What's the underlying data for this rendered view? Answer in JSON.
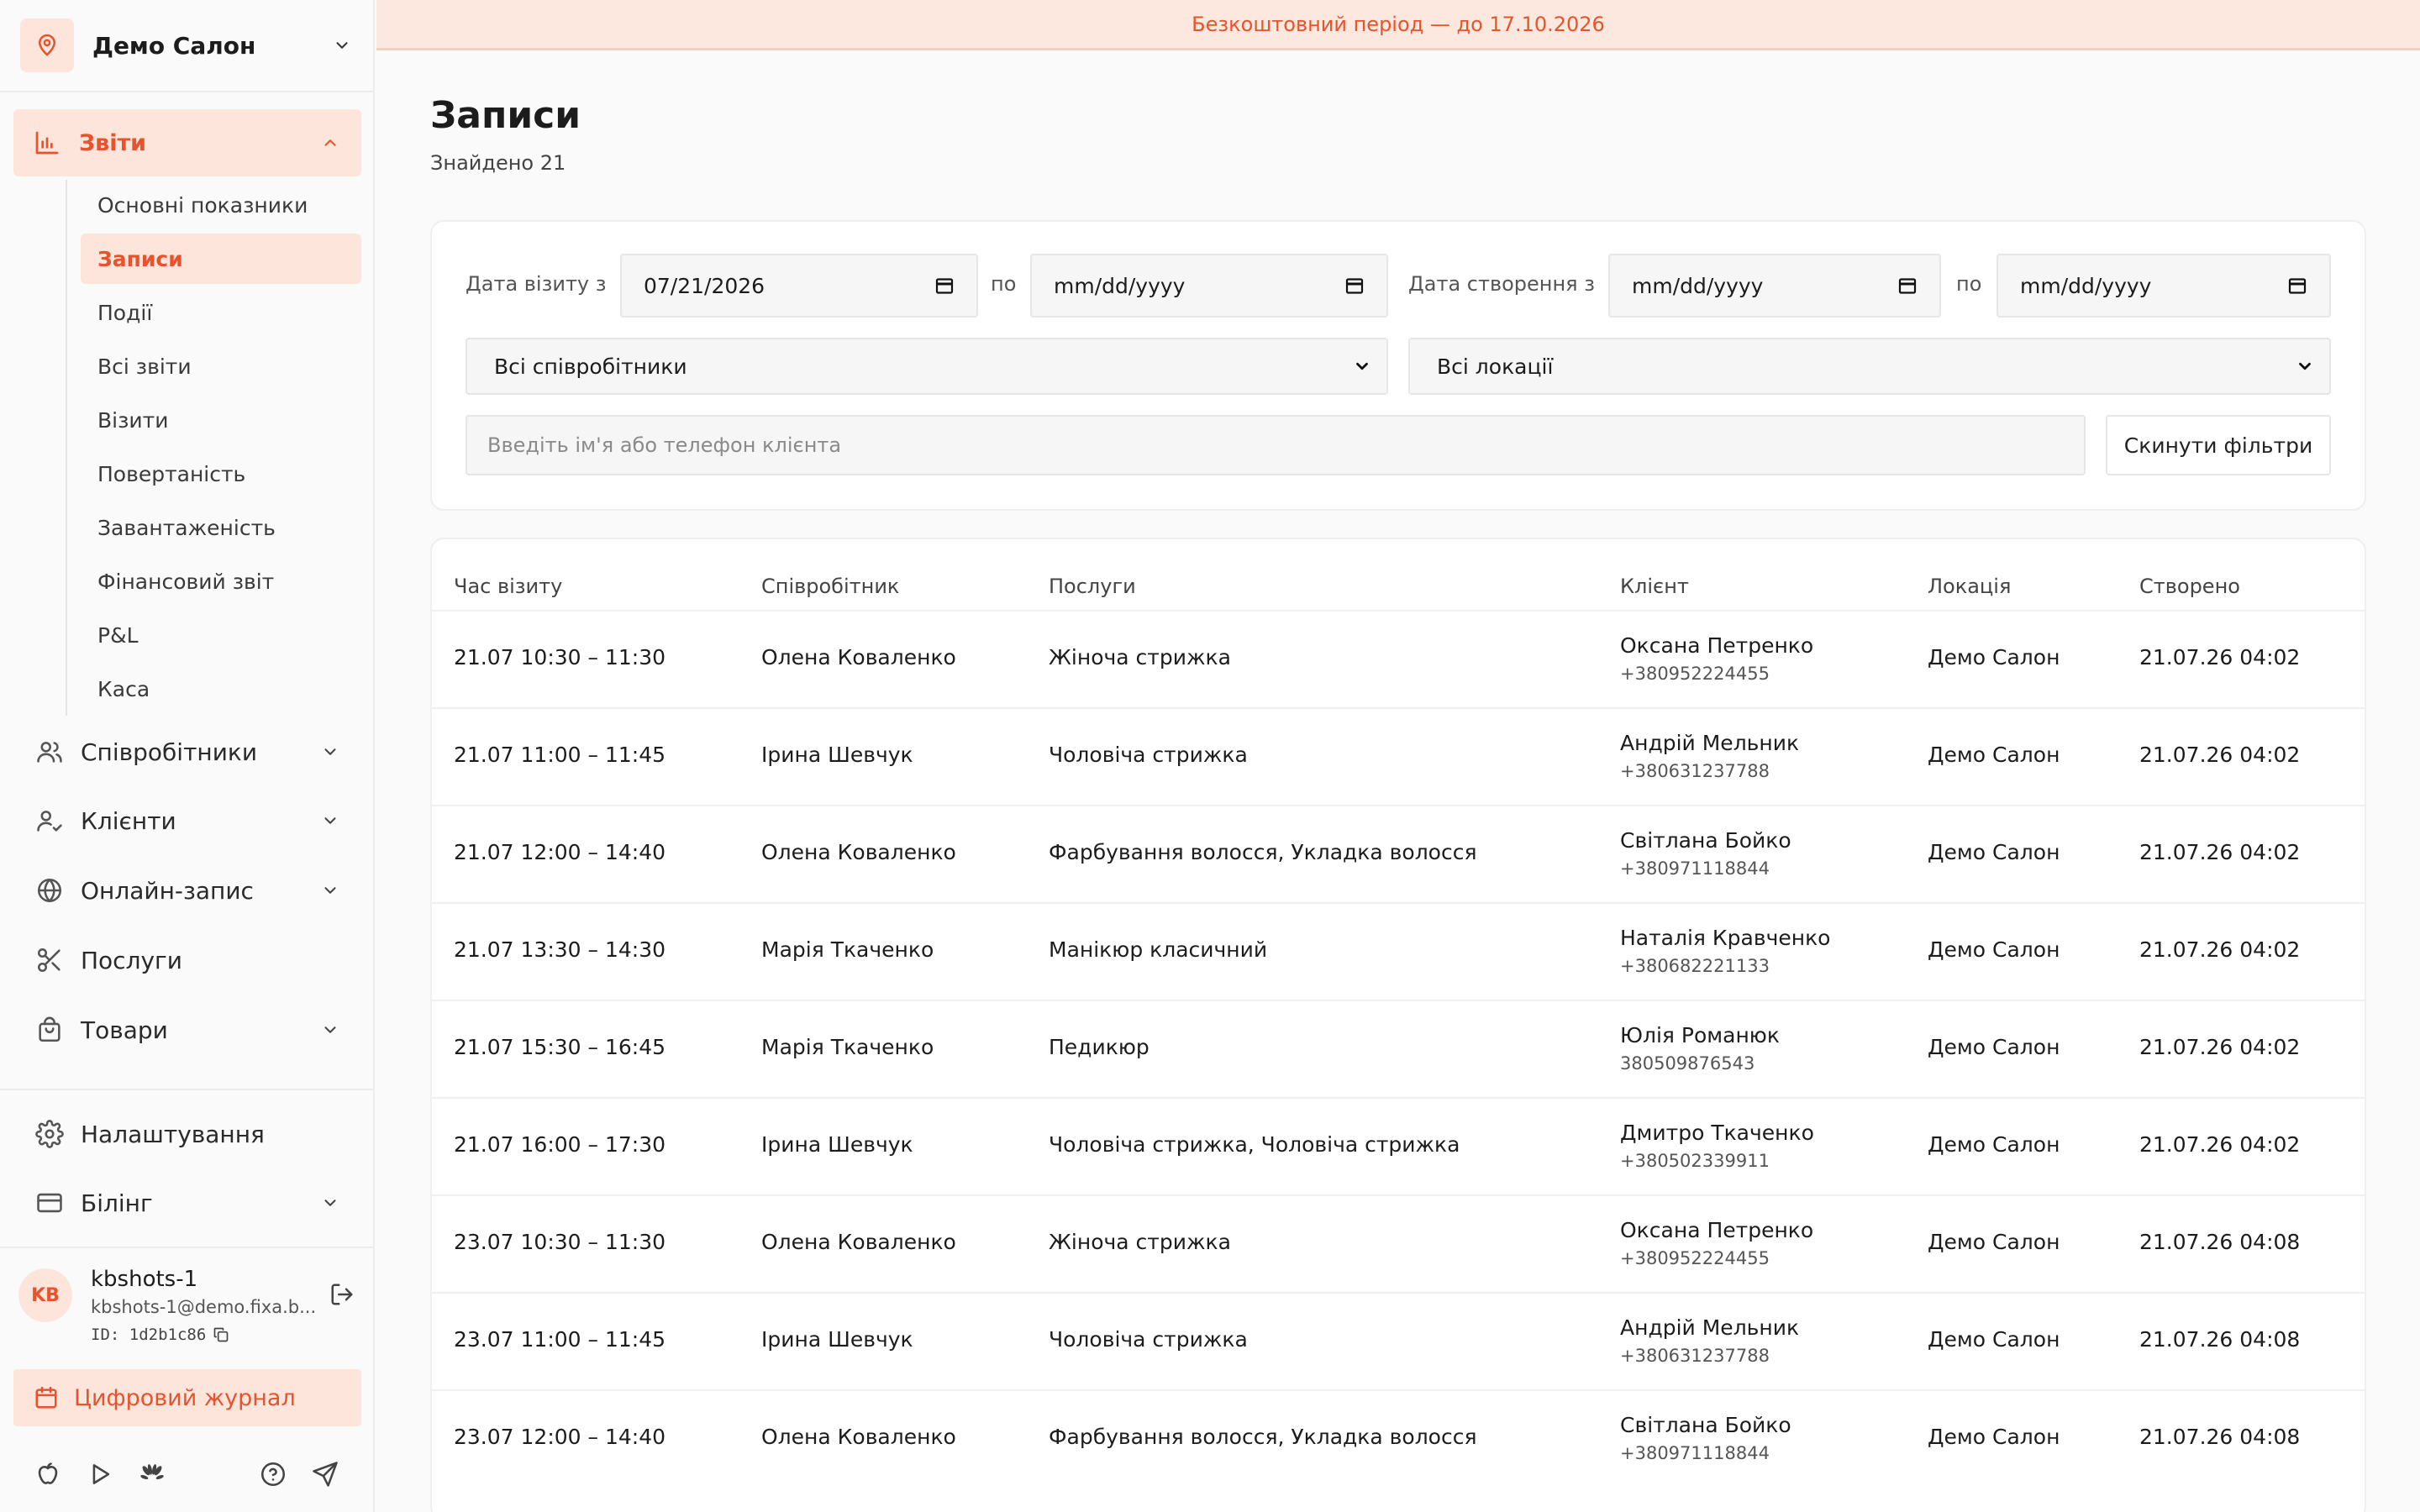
{
  "colors": {
    "accent": "#e8532c",
    "accent_bg": "#fde5dc",
    "banner_bg": "#fde8e0"
  },
  "banner": {
    "text": "Безкоштовний період — до 17.10.2026"
  },
  "salon": {
    "name": "Демо Салон",
    "icon": "map-pin-icon"
  },
  "sidebar": {
    "reports": {
      "label": "Звіти",
      "icon": "bar-chart-icon"
    },
    "sub_items": [
      {
        "label": "Основні показники",
        "active": false
      },
      {
        "label": "Записи",
        "active": true
      },
      {
        "label": "Події",
        "active": false
      },
      {
        "label": "Всі звіти",
        "active": false
      },
      {
        "label": "Візити",
        "active": false
      },
      {
        "label": "Повертаність",
        "active": false
      },
      {
        "label": "Завантаженість",
        "active": false
      },
      {
        "label": "Фінансовий звіт",
        "active": false
      },
      {
        "label": "P&L",
        "active": false
      },
      {
        "label": "Каса",
        "active": false
      }
    ],
    "nav": [
      {
        "label": "Співробітники",
        "icon": "users-icon",
        "expandable": true
      },
      {
        "label": "Клієнти",
        "icon": "user-check-icon",
        "expandable": true
      },
      {
        "label": "Онлайн-запис",
        "icon": "globe-icon",
        "expandable": true
      },
      {
        "label": "Послуги",
        "icon": "scissors-icon",
        "expandable": false
      },
      {
        "label": "Товари",
        "icon": "shopping-bag-icon",
        "expandable": true
      }
    ],
    "settings": {
      "label": "Налаштування",
      "icon": "gear-icon"
    },
    "billing": {
      "label": "Білінг",
      "icon": "credit-card-icon"
    },
    "user": {
      "initials": "KB",
      "name": "kbshots-1",
      "email": "kbshots-1@demo.fixa.b...",
      "id": "ID: 1d2b1c86"
    },
    "journal": {
      "label": "Цифровий журнал",
      "icon": "calendar-icon"
    }
  },
  "main": {
    "title": "Записи",
    "found": "Знайдено 21",
    "filters": {
      "visit_date_label": "Дата візиту з",
      "visit_date_from": "07/21/2026",
      "to_label": "по",
      "visit_date_to": "mm/dd/yyyy",
      "created_label": "Дата створення з",
      "created_from": "mm/dd/yyyy",
      "created_to": "mm/dd/yyyy",
      "employees": "Всі співробітники",
      "locations": "Всі локації",
      "search_placeholder": "Введіть ім'я або телефон клієнта",
      "reset": "Скинути фільтри"
    },
    "table": {
      "headers": [
        "Час візиту",
        "Співробітник",
        "Послуги",
        "Клієнт",
        "Локація",
        "Створено"
      ],
      "rows": [
        {
          "time": "21.07 10:30 – 11:30",
          "employee": "Олена Коваленко",
          "services": "Жіноча стрижка",
          "client": "Оксана Петренко",
          "phone": "+380952224455",
          "location": "Демо Салон",
          "created": "21.07.26 04:02"
        },
        {
          "time": "21.07 11:00 – 11:45",
          "employee": "Ірина Шевчук",
          "services": "Чоловіча стрижка",
          "client": "Андрій Мельник",
          "phone": "+380631237788",
          "location": "Демо Салон",
          "created": "21.07.26 04:02"
        },
        {
          "time": "21.07 12:00 – 14:40",
          "employee": "Олена Коваленко",
          "services": "Фарбування волосся, Укладка волосся",
          "client": "Світлана Бойко",
          "phone": "+380971118844",
          "location": "Демо Салон",
          "created": "21.07.26 04:02"
        },
        {
          "time": "21.07 13:30 – 14:30",
          "employee": "Марія Ткаченко",
          "services": "Манікюр класичний",
          "client": "Наталія Кравченко",
          "phone": "+380682221133",
          "location": "Демо Салон",
          "created": "21.07.26 04:02"
        },
        {
          "time": "21.07 15:30 – 16:45",
          "employee": "Марія Ткаченко",
          "services": "Педикюр",
          "client": "Юлія Романюк",
          "phone": "380509876543",
          "location": "Демо Салон",
          "created": "21.07.26 04:02"
        },
        {
          "time": "21.07 16:00 – 17:30",
          "employee": "Ірина Шевчук",
          "services": "Чоловіча стрижка, Чоловіча стрижка",
          "client": "Дмитро Ткаченко",
          "phone": "+380502339911",
          "location": "Демо Салон",
          "created": "21.07.26 04:02"
        },
        {
          "time": "23.07 10:30 – 11:30",
          "employee": "Олена Коваленко",
          "services": "Жіноча стрижка",
          "client": "Оксана Петренко",
          "phone": "+380952224455",
          "location": "Демо Салон",
          "created": "21.07.26 04:08"
        },
        {
          "time": "23.07 11:00 – 11:45",
          "employee": "Ірина Шевчук",
          "services": "Чоловіча стрижка",
          "client": "Андрій Мельник",
          "phone": "+380631237788",
          "location": "Демо Салон",
          "created": "21.07.26 04:08"
        },
        {
          "time": "23.07 12:00 – 14:40",
          "employee": "Олена Коваленко",
          "services": "Фарбування волосся, Укладка волосся",
          "client": "Світлана Бойко",
          "phone": "+380971118844",
          "location": "Демо Салон",
          "created": "21.07.26 04:08"
        }
      ]
    }
  }
}
